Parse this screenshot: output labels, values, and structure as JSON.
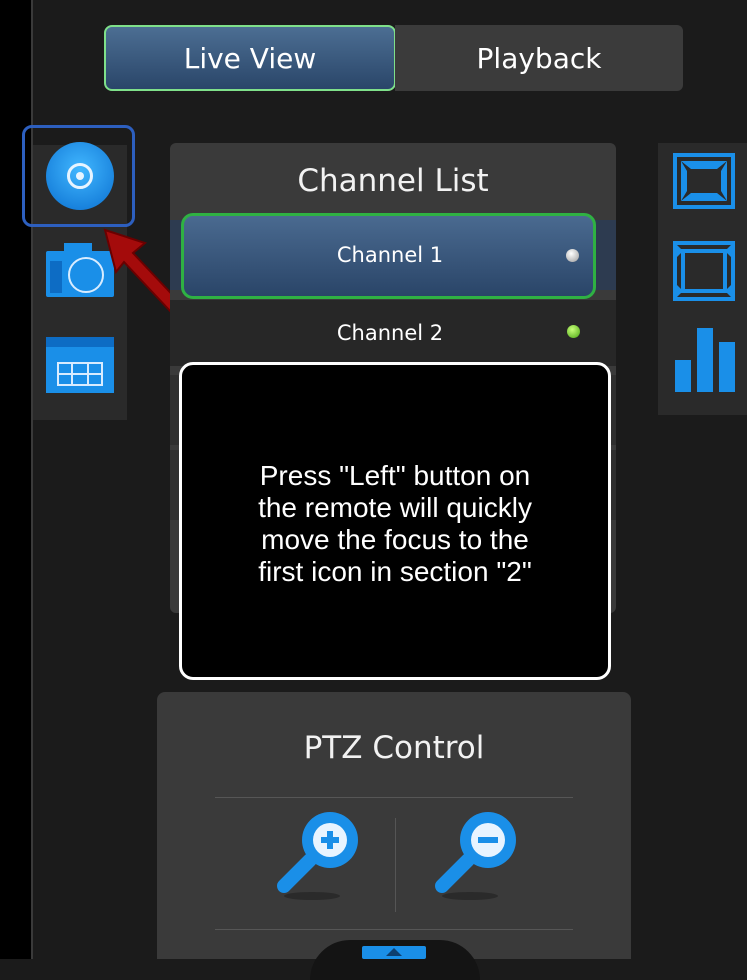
{
  "tabs": {
    "live": "Live View",
    "playback": "Playback"
  },
  "channel_list": {
    "title": "Channel List",
    "channels": [
      {
        "label": "Channel 1",
        "status_color": "#bdbdbd"
      },
      {
        "label": "Channel 2",
        "status_color": "#6fd321"
      }
    ]
  },
  "tooltip": {
    "text": "Press \"Left\" button on\nthe remote will quickly\nmove the focus to the\nfirst icon in section \"2\""
  },
  "ptz": {
    "title": "PTZ Control"
  },
  "left_icons": [
    "disc-icon",
    "camera-icon",
    "calendar-icon"
  ],
  "right_icons": [
    "fullscreen-icon",
    "aspect-ratio-icon",
    "bar-chart-icon"
  ],
  "colors": {
    "focus_blue": "#2d5fbf",
    "focus_green": "#2fb143",
    "tab_active": "#3a5a80",
    "icon_blue": "#1a8fe8"
  }
}
